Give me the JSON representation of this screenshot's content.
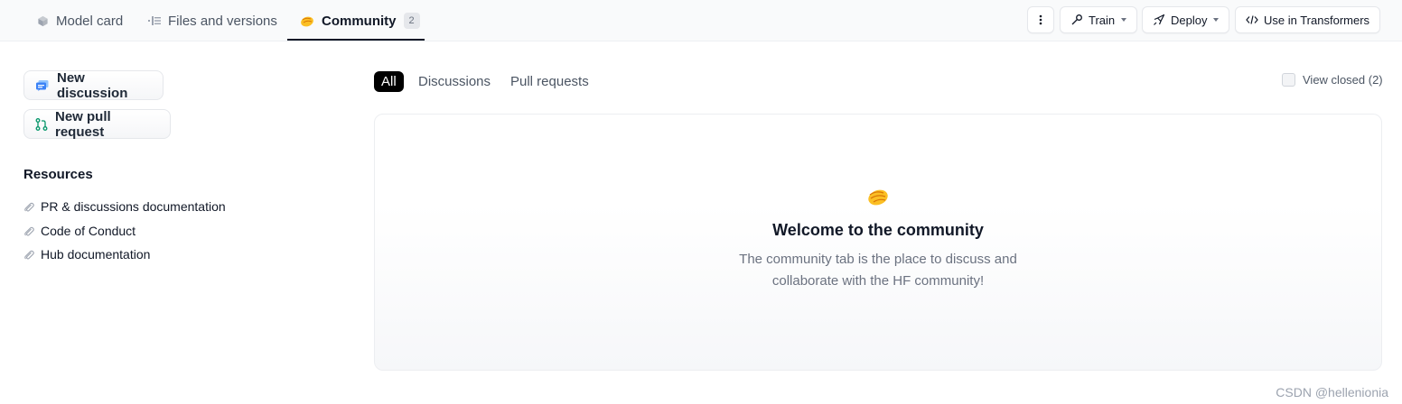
{
  "tabs": [
    {
      "label": "Model card",
      "icon": "cube-icon"
    },
    {
      "label": "Files and versions",
      "icon": "files-icon"
    },
    {
      "label": "Community",
      "icon": "clapping-hands-icon",
      "badge": "2",
      "active": true
    }
  ],
  "toolbar": {
    "more_icon": "vertical-dots-icon",
    "train_label": "Train",
    "deploy_label": "Deploy",
    "use_label": "Use in Transformers"
  },
  "sidebar": {
    "new_discussion_label": "New discussion",
    "new_pr_label": "New pull request",
    "resources_title": "Resources",
    "resources": [
      "PR & discussions documentation",
      "Code of Conduct",
      "Hub documentation"
    ]
  },
  "filters": {
    "items": [
      "All",
      "Discussions",
      "Pull requests"
    ],
    "active": "All",
    "view_closed_label": "View closed (2)"
  },
  "empty_state": {
    "title": "Welcome to the community",
    "line1": "The community tab is the place to discuss and",
    "line2": "collaborate with the HF community!"
  },
  "watermark": "CSDN @hellenionia",
  "colors": {
    "accent_dark": "#111827",
    "muted": "#6b7280",
    "discussion_icon_blue": "#3b82f6",
    "pr_icon_green": "#059669",
    "clap_yellow": "#fbbf24"
  }
}
